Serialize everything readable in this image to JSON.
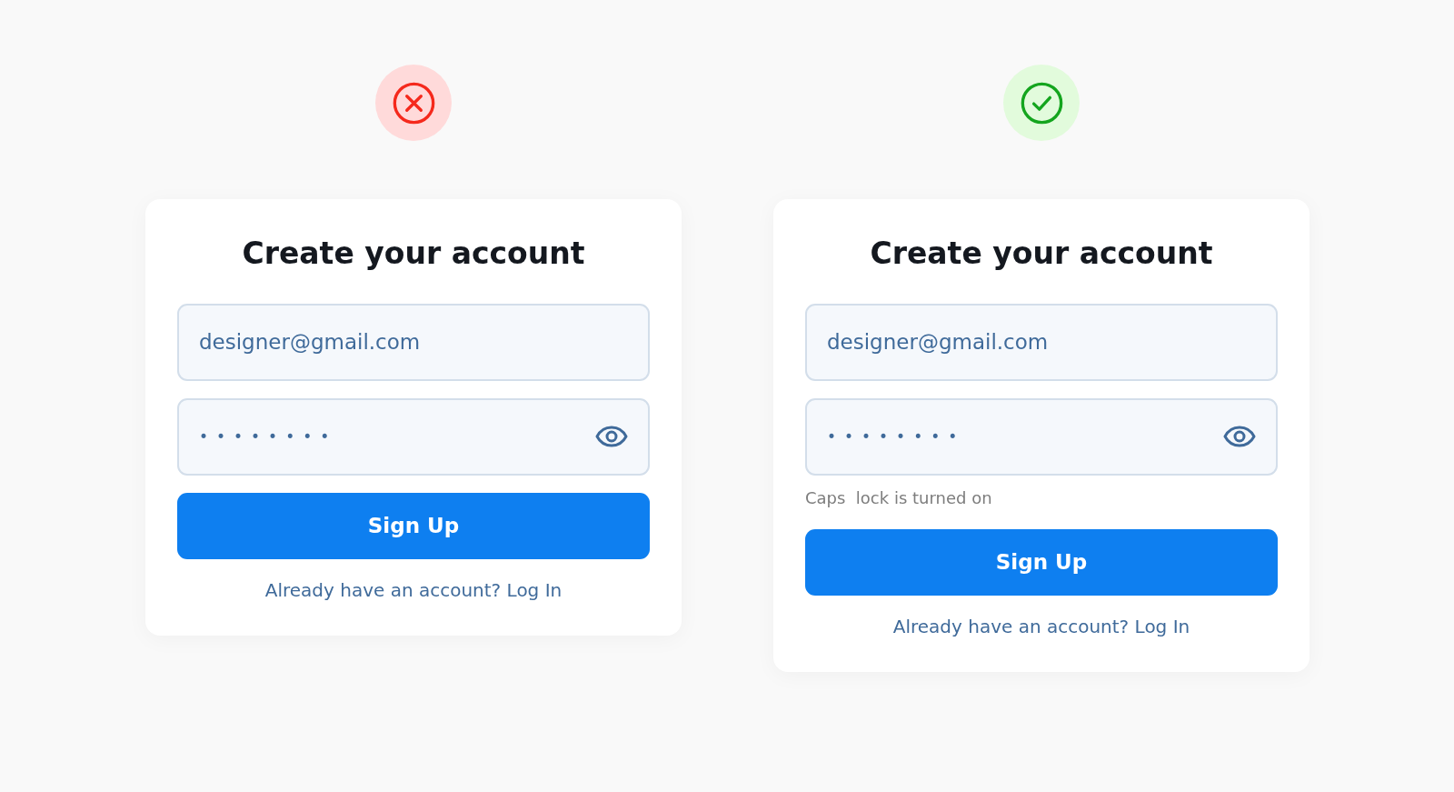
{
  "panels": [
    {
      "kind": "error",
      "title": "Create your account",
      "email": {
        "value": "designer@gmail.com"
      },
      "password": {
        "value": "••••••••"
      },
      "button": "Sign Up",
      "login_prompt": "Already have an account? Log In"
    },
    {
      "kind": "success",
      "title": "Create your account",
      "email": {
        "value": "designer@gmail.com"
      },
      "password": {
        "value": "••••••••"
      },
      "hint": "Caps  lock is turned on",
      "button": "Sign Up",
      "login_prompt": "Already have an account? Log In"
    }
  ]
}
